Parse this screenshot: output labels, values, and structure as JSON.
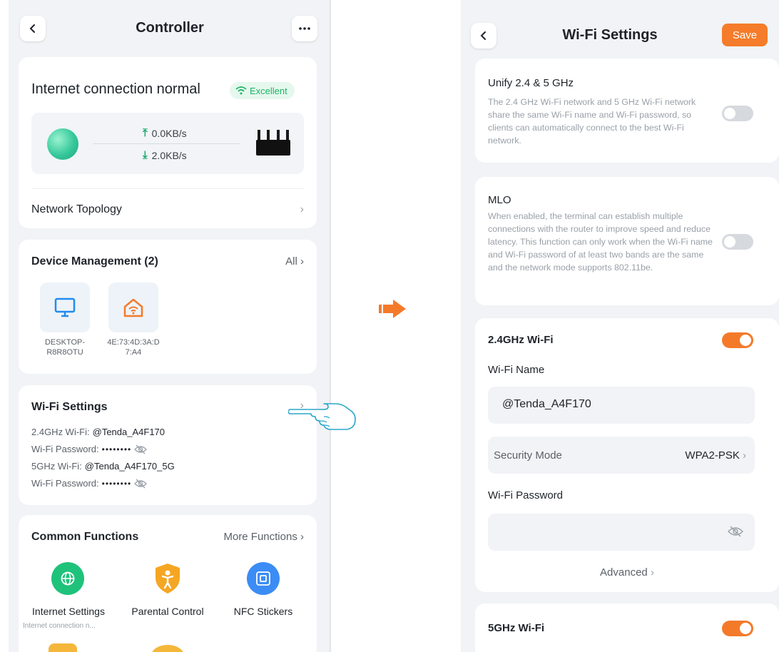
{
  "controller": {
    "title": "Controller",
    "connection_status": "Internet connection normal",
    "signal_badge": "Excellent",
    "upload_speed": "0.0KB/s",
    "download_speed": "2.0KB/s",
    "network_topology": "Network Topology",
    "device_management_title": "Device Management (2)",
    "all_link": "All",
    "devices": [
      {
        "name": "DESKTOP-\nR8R8OTU",
        "icon": "monitor-icon"
      },
      {
        "name": "4E:73:4D:3A:D\n7:A4",
        "icon": "home-wifi-icon"
      }
    ],
    "wifi_settings_title": "Wi-Fi Settings",
    "wifi_24_label": "2.4GHz Wi-Fi:",
    "wifi_24_name": "@Tenda_A4F170",
    "wifi_password_label": "Wi-Fi Password:",
    "wifi_password_masked": "••••••••",
    "wifi_5_label": "5GHz Wi-Fi:",
    "wifi_5_name": "@Tenda_A4F170_5G",
    "common_functions_title": "Common Functions",
    "more_functions": "More Functions",
    "functions": [
      {
        "label": "Internet Settings",
        "sub": "Internet connection n...",
        "icon": "globe-icon",
        "color": "#1fc27a"
      },
      {
        "label": "Parental Control",
        "sub": "",
        "icon": "shield-child-icon",
        "color": "#f5a623"
      },
      {
        "label": "NFC Stickers",
        "sub": "",
        "icon": "nfc-icon",
        "color": "#3b8cf5"
      }
    ]
  },
  "wifi_settings": {
    "title": "Wi-Fi Settings",
    "save_label": "Save",
    "unify": {
      "title": "Unify 2.4 & 5 GHz",
      "description": "The 2.4 GHz Wi-Fi network and 5 GHz Wi-Fi network share the same Wi-Fi name and Wi-Fi password, so clients can automatically connect to the best Wi-Fi network.",
      "enabled": false
    },
    "mlo": {
      "title": "MLO",
      "description": "When enabled, the terminal can establish multiple connections with the router to improve speed and reduce latency. This function can only work when the Wi-Fi name and Wi-Fi password of at least two bands are the same and the network mode supports 802.11be.",
      "enabled": false
    },
    "band_24": {
      "title": "2.4GHz Wi-Fi",
      "enabled": true,
      "name_label": "Wi-Fi Name",
      "name_value": "@Tenda_A4F170",
      "security_label": "Security Mode",
      "security_value": "WPA2-PSK",
      "password_label": "Wi-Fi Password",
      "advanced_label": "Advanced"
    },
    "band_5": {
      "title": "5GHz Wi-Fi",
      "enabled": true
    }
  },
  "colors": {
    "accent_orange": "#f47a2a",
    "success_green": "#1db565"
  }
}
